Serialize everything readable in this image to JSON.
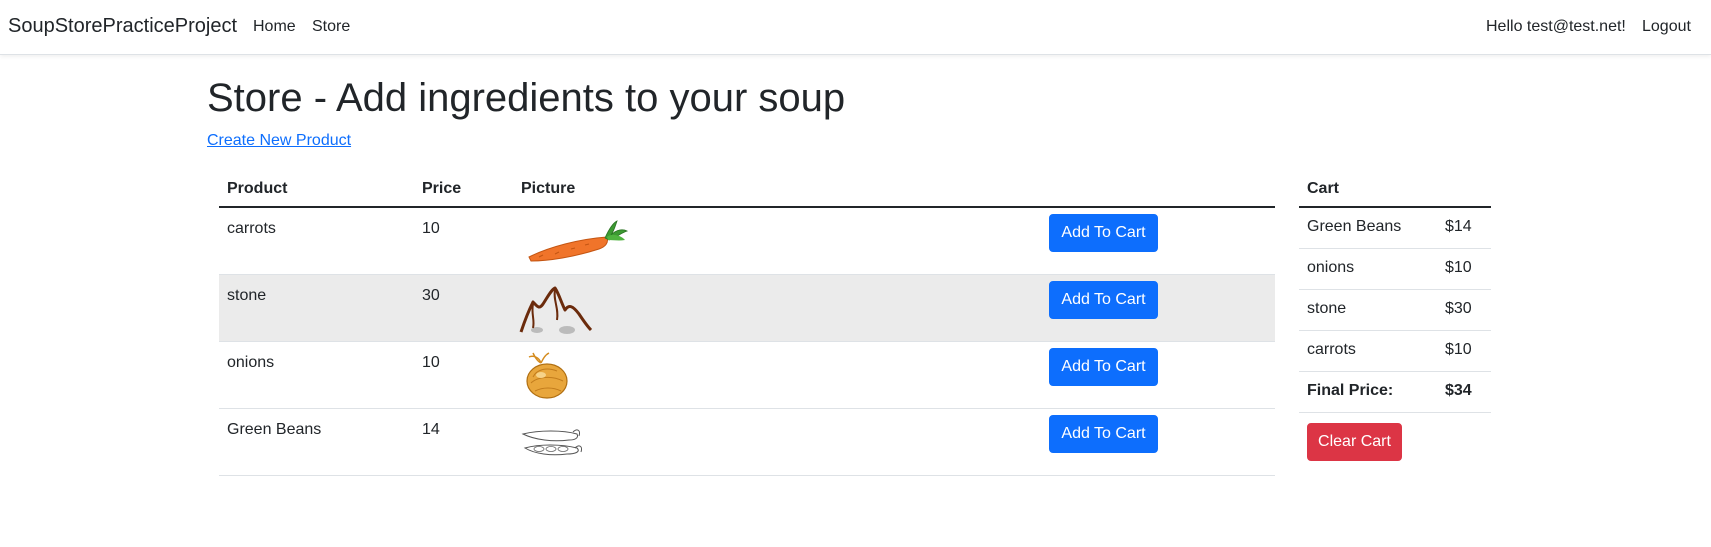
{
  "navbar": {
    "brand": "SoupStorePracticeProject",
    "links": [
      "Home",
      "Store"
    ],
    "greeting": "Hello test@test.net!",
    "logout": "Logout"
  },
  "page": {
    "title": "Store - Add ingredients to your soup",
    "create_link": "Create New Product"
  },
  "products": {
    "headers": [
      "Product",
      "Price",
      "Picture"
    ],
    "rows": [
      {
        "name": "carrots",
        "price": "10",
        "picture": "carrot-image",
        "button": "Add To Cart"
      },
      {
        "name": "stone",
        "price": "30",
        "picture": "stone-image",
        "button": "Add To Cart"
      },
      {
        "name": "onions",
        "price": "10",
        "picture": "onion-image",
        "button": "Add To Cart"
      },
      {
        "name": "Green Beans",
        "price": "14",
        "picture": "green-beans-image",
        "button": "Add To Cart"
      }
    ]
  },
  "cart": {
    "header": "Cart",
    "items": [
      {
        "name": "Green Beans",
        "price": "$14"
      },
      {
        "name": "onions",
        "price": "$10"
      },
      {
        "name": "stone",
        "price": "$30"
      },
      {
        "name": "carrots",
        "price": "$10"
      }
    ],
    "final_label": "Final Price:",
    "final_value": "$34",
    "clear_button": "Clear Cart"
  },
  "colors": {
    "primary": "#0d6efd",
    "danger": "#dc3545",
    "link": "#0d6efd",
    "striped_row": "#ebebeb"
  }
}
